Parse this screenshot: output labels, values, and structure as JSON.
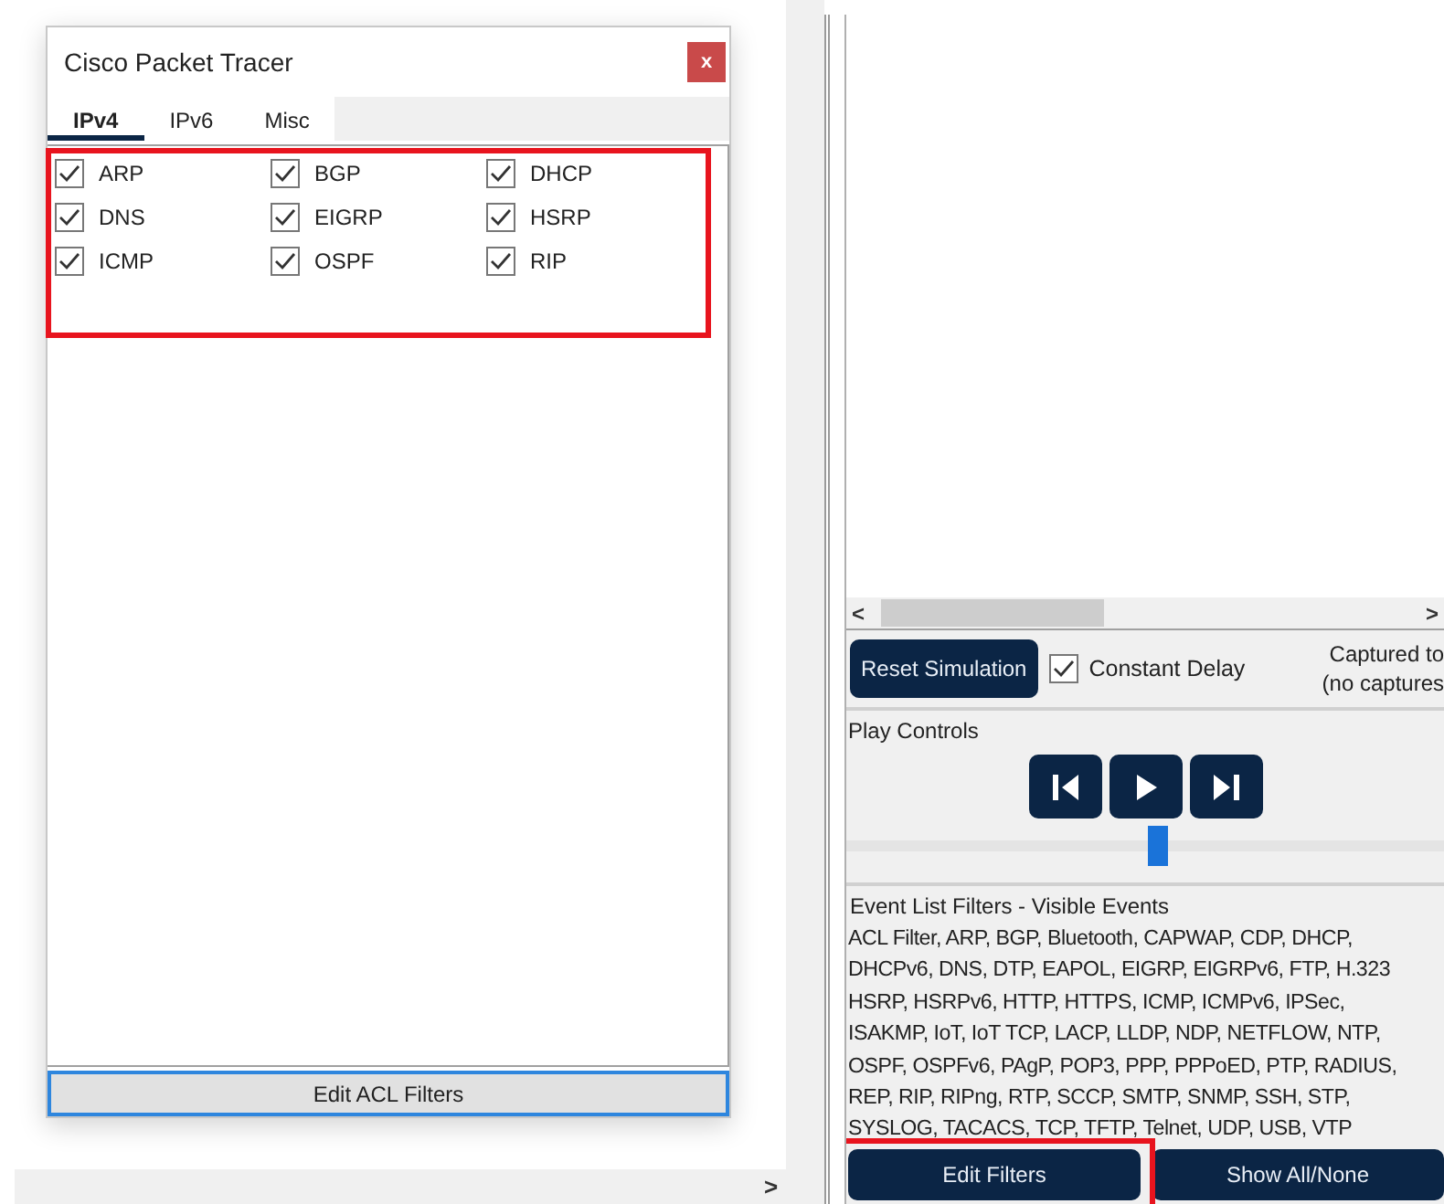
{
  "dialog": {
    "title": "Cisco Packet Tracer",
    "close": "x",
    "tabs": [
      {
        "label": "IPv4",
        "selected": true
      },
      {
        "label": "IPv6",
        "selected": false
      },
      {
        "label": "Misc",
        "selected": false
      }
    ],
    "filters": [
      {
        "label": "ARP",
        "checked": true
      },
      {
        "label": "BGP",
        "checked": true
      },
      {
        "label": "DHCP",
        "checked": true
      },
      {
        "label": "DNS",
        "checked": true
      },
      {
        "label": "EIGRP",
        "checked": true
      },
      {
        "label": "HSRP",
        "checked": true
      },
      {
        "label": "ICMP",
        "checked": true
      },
      {
        "label": "OSPF",
        "checked": true
      },
      {
        "label": "RIP",
        "checked": true
      }
    ],
    "highlighted": true,
    "button": "Edit ACL Filters"
  },
  "left_scroll": {
    "arrow": ">"
  },
  "event_list": {
    "scroll_arrow_left": "<",
    "scroll_arrow_right": ">"
  },
  "simulation": {
    "reset_button": "Reset Simulation",
    "constant_delay": {
      "label": "Constant Delay",
      "checked": true
    },
    "captured": [
      "Captured to",
      "(no captures"
    ]
  },
  "play_controls": {
    "title": "Play Controls",
    "slider": {
      "level": 0.52
    }
  },
  "event_filters": {
    "title": "Event List Filters - Visible Events",
    "lines": [
      "ACL Filter, ARP, BGP, Bluetooth, CAPWAP, CDP, DHCP,",
      "DHCPv6, DNS, DTP, EAPOL, EIGRP, EIGRPv6, FTP, H.323",
      "HSRP, HSRPv6, HTTP, HTTPS, ICMP, ICMPv6, IPSec,",
      "ISAKMP, IoT, IoT TCP, LACP, LLDP, NDP, NETFLOW, NTP,",
      "OSPF, OSPFv6, PAgP, POP3, PPP, PPPoED, PTP, RADIUS,",
      "REP, RIP, RIPng, RTP, SCCP, SMTP, SNMP, SSH, STP,",
      "SYSLOG, TACACS, TCP, TFTP, Telnet, UDP, USB, VTP"
    ],
    "edit_button": "Edit Filters",
    "edit_highlighted": true,
    "show_button": "Show All/None"
  }
}
